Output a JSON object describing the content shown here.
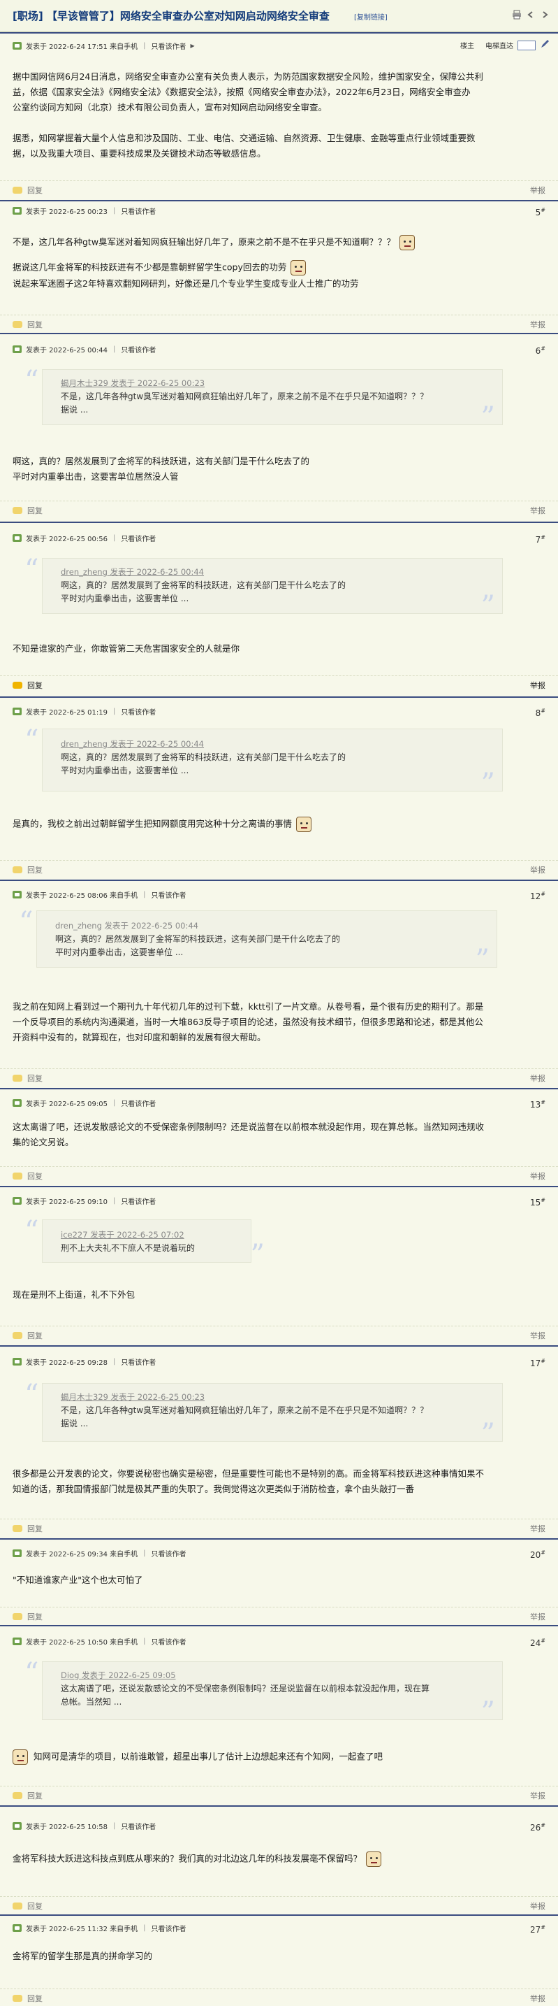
{
  "header": {
    "title": "[职场] 【早该管管了】网络安全审查办公室对知网启动网络安全审查",
    "copy_link": "[复制链接]",
    "owner_label": "楼主",
    "font_label": "电梯直达"
  },
  "colors": {
    "border": "#3a4c80",
    "bg": "#f7f8ea",
    "title": "#123a7a"
  },
  "posts": [
    {
      "meta": "发表于 2022-6-24 17:51 来自手机",
      "only_author": "只看该作者",
      "lines": [
        "据中国网信网6月24日消息，网络安全审查办公室有关负责人表示，为防范国家数据安全风险，维护国家安全，保障公共利",
        "益，依据《国家安全法》《网络安全法》《数据安全法》，按照《网络安全审查办法》，2022年6月23日，网络安全审查办",
        "公室约谈同方知网（北京）技术有限公司负责人，宣布对知网启动网络安全审查。",
        "",
        "据悉，知网掌握着大量个人信息和涉及国防、工业、电信、交通运输、自然资源、卫生健康、金融等重点行业领域重要数",
        "据，以及我重大项目、重要科技成果及关键技术动态等敏感信息。"
      ],
      "reply": "回复",
      "report": "举报"
    },
    {
      "meta": "发表于 2022-6-25 00:23",
      "only_author": "只看该作者",
      "no": "5",
      "lines": [
        "不是，这几年各种gtw臭军迷对着知网疯狂输出好几年了，原来之前不是不在乎只是不知道啊？？？",
        "据说这几年金将军的科技跃进有不少都是靠朝鲜留学生copy回去的功劳",
        "说起来军迷圈子这2年特喜欢翻知网研判，好像还是几个专业学生变成专业人士推广的功劳"
      ],
      "reply": "回复",
      "report": "举报"
    },
    {
      "meta": "发表于 2022-6-25 00:44",
      "only_author": "只看该作者",
      "no": "6",
      "quote_head": "蝎月木士329 发表于 2022-6-25 00:23",
      "quote_lines": [
        "不是，这几年各种gtw臭军迷对着知网疯狂输出好几年了，原来之前不是不在乎只是不知道啊？？？",
        "据说 ..."
      ],
      "lines": [
        "啊这，真的？居然发展到了金将军的科技跃进，这有关部门是干什么吃去了的",
        "平时对内重拳出击，这要害单位居然没人管"
      ],
      "reply": "回复",
      "report": "举报"
    },
    {
      "meta": "发表于 2022-6-25 00:56",
      "only_author": "只看该作者",
      "no": "7",
      "quote_head": "dren_zheng 发表于 2022-6-25 00:44",
      "quote_lines": [
        "啊这，真的？居然发展到了金将军的科技跃进，这有关部门是干什么吃去了的",
        "平时对内重拳出击，这要害单位 ..."
      ],
      "lines": [
        "不知是谁家的产业，你敢管第二天危害国家安全的人就是你"
      ],
      "reply": "回复",
      "report": "举报"
    },
    {
      "meta": "发表于 2022-6-25 01:19",
      "only_author": "只看该作者",
      "no": "8",
      "quote_head": "dren_zheng 发表于 2022-6-25 00:44",
      "quote_lines": [
        "啊这，真的？居然发展到了金将军的科技跃进，这有关部门是干什么吃去了的",
        "平时对内重拳出击，这要害单位 ..."
      ],
      "lines": [
        "是真的，我校之前出过朝鲜留学生把知网额度用完这种十分之离谱的事情"
      ],
      "reply": "回复",
      "report": "举报"
    },
    {
      "meta": "发表于 2022-6-25 08:06 来自手机",
      "only_author": "只看该作者",
      "no": "12",
      "quote_head": "dren_zheng 发表于 2022-6-25 00:44",
      "quote_lines": [
        "啊这，真的？居然发展到了金将军的科技跃进，这有关部门是干什么吃去了的",
        "平时对内重拳出击，这要害单位 ..."
      ],
      "lines": [
        "我之前在知网上看到过一个期刊九十年代初几年的过刊下载，kktt引了一片文章。从卷号看，是个很有历史的期刊了。那是",
        "一个反导项目的系统内沟通渠道，当时一大堆863反导子项目的论述，虽然没有技术细节，但很多思路和论述，都是其他公",
        "开资料中没有的，就算现在，也对印度和朝鲜的发展有很大帮助。"
      ],
      "reply": "回复",
      "report": "举报"
    },
    {
      "meta": "发表于 2022-6-25 09:05",
      "only_author": "只看该作者",
      "no": "13",
      "lines": [
        "这太离谱了吧，还说发散感论文的不受保密条例限制吗？还是说监督在以前根本就没起作用，现在算总帐。当然知网违规收",
        "集的论文另说。"
      ],
      "reply": "回复",
      "report": "举报"
    },
    {
      "meta": "发表于 2022-6-25 09:10",
      "only_author": "只看该作者",
      "no": "15",
      "quote_head": "ice227 发表于 2022-6-25 07:02",
      "quote_lines": [
        "刑不上大夫礼不下庶人不是说着玩的"
      ],
      "lines": [
        "现在是刑不上街道，礼不下外包"
      ],
      "reply": "回复",
      "report": "举报"
    },
    {
      "meta": "发表于 2022-6-25 09:28",
      "only_author": "只看该作者",
      "no": "17",
      "quote_head": "蝎月木士329 发表于 2022-6-25 00:23",
      "quote_lines": [
        "不是，这几年各种gtw臭军迷对着知网疯狂输出好几年了，原来之前不是不在乎只是不知道啊？？？",
        "据说 ..."
      ],
      "lines": [
        "很多都是公开发表的论文，你要说秘密也确实是秘密，但是重要性可能也不是特别的高。而金将军科技跃进这种事情如果不",
        "知道的话，那我国情报部门就是极其严重的失职了。我倒觉得这次更类似于消防检查，拿个由头敲打一番"
      ],
      "reply": "回复",
      "report": "举报"
    },
    {
      "meta": "发表于 2022-6-25 09:34 来自手机",
      "only_author": "只看该作者",
      "no": "20",
      "lines": [
        "\"不知道谁家产业\"这个也太可怕了"
      ],
      "reply": "回复",
      "report": "举报"
    },
    {
      "meta": "发表于 2022-6-25 10:50 来自手机",
      "only_author": "只看该作者",
      "no": "24",
      "quote_head": "Diog 发表于 2022-6-25 09:05",
      "quote_lines": [
        "这太离谱了吧，还说发散感论文的不受保密条例限制吗？还是说监督在以前根本就没起作用，现在算",
        "总帐。当然知 ..."
      ],
      "lines": [
        "知网可是清华的项目，以前谁敢管，超星出事儿了估计上边想起来还有个知网，一起查了吧"
      ],
      "reply": "回复",
      "report": "举报"
    },
    {
      "meta": "发表于 2022-6-25 10:58",
      "only_author": "只看该作者",
      "no": "26",
      "lines": [
        "金将军科技大跃进这科技点到底从哪来的？我们真的对北边这几年的科技发展毫不保留吗？"
      ],
      "reply": "回复",
      "report": "举报"
    },
    {
      "meta": "发表于 2022-6-25 11:32 来自手机",
      "only_author": "只看该作者",
      "no": "27",
      "lines": [
        "金将军的留学生那是真的拼命学习的"
      ],
      "reply": "回复",
      "report": "举报"
    }
  ]
}
